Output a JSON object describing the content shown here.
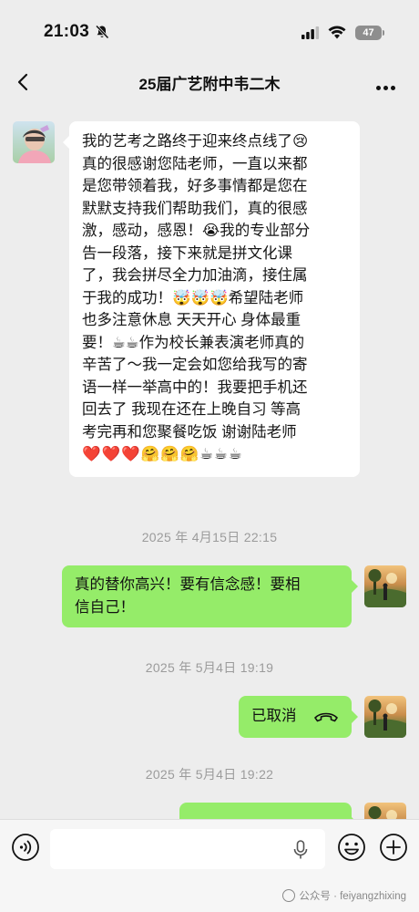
{
  "status_bar": {
    "time": "21:03",
    "battery": "47"
  },
  "nav": {
    "title": "25届广艺附中韦二木"
  },
  "messages": [
    {
      "from": "contact",
      "lines": [
        "我的艺考之路终于迎来终点线了😢",
        "真的很感谢您陆老师，一直以来都",
        "是您带领着我，好多事情都是您在",
        "默默支持我们帮助我们，真的很感",
        "激，感动，感恩！😭我的专业部分",
        "告一段落，接下来就是拼文化课",
        "了，我会拼尽全力加油滴，接住属",
        "于我的成功！🤯🤯🤯希望陆老师",
        "也多注意休息 天天开心 身体最重",
        "要！☕☕作为校长兼表演老师真的",
        "辛苦了～我一定会如您给我写的寄",
        "语一样一举高中的！我要把手机还",
        "回去了 我现在还在上晚自习 等高",
        "考完再和您聚餐吃饭 谢谢陆老师"
      ],
      "emojis": "❤️❤️❤️🤗🤗🤗☕☕☕"
    },
    {
      "timestamp": "2025 年 4月15日 22:15"
    },
    {
      "from": "me",
      "lines": [
        "真的替你高兴！要有信念感！要相",
        "信自己！"
      ]
    },
    {
      "timestamp": "2025 年 5月4日 19:19"
    },
    {
      "from": "me",
      "text": "已取消",
      "call_icon": "hangup-phone-icon"
    },
    {
      "timestamp": "2025 年 5月4日 19:22"
    }
  ],
  "input": {
    "placeholder": ""
  },
  "watermark": "公众号 · feiyangzhixing",
  "colors": {
    "background": "#ededed",
    "bubble_green": "#95ec69",
    "bubble_white": "#ffffff",
    "timestamp": "#9b9b9b"
  }
}
